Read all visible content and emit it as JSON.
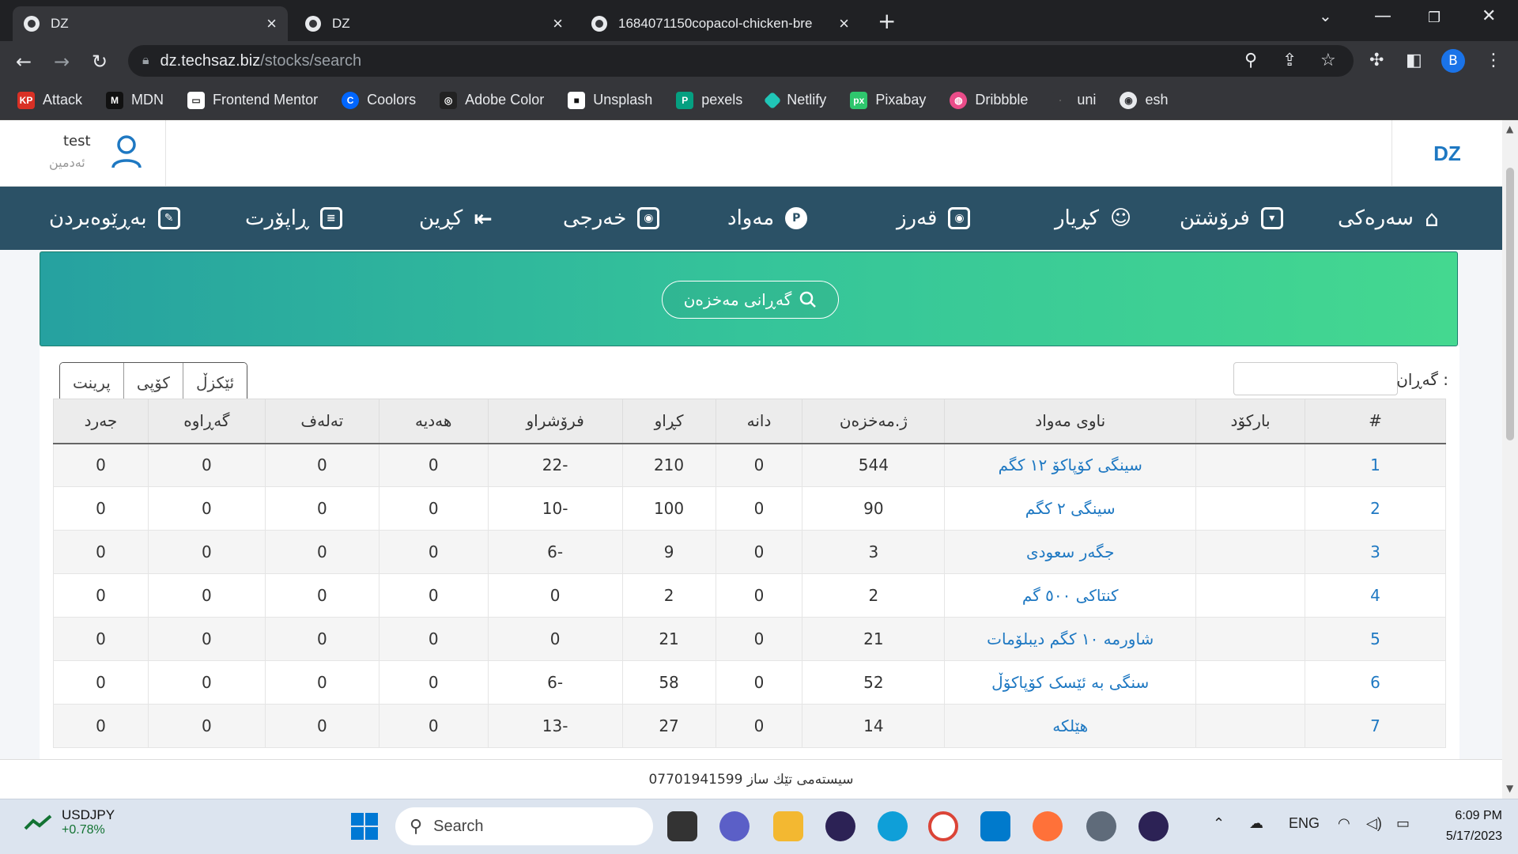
{
  "browser": {
    "tabs": [
      {
        "title": "DZ"
      },
      {
        "title": "DZ"
      },
      {
        "title": "1684071150copacol-chicken-bre"
      }
    ],
    "new_tab": "+",
    "url_host": "dz.techsaz.biz",
    "url_path": "/stocks/search",
    "profile_initial": "B",
    "bookmarks": [
      "Attack",
      "MDN",
      "Frontend Mentor",
      "Coolors",
      "Adobe Color",
      "Unsplash",
      "pexels",
      "Netlify",
      "Pixabay",
      "Dribbble",
      "uni",
      "esh"
    ]
  },
  "header": {
    "user_name": "test",
    "user_role": "ئەدمین",
    "brand": "DZ"
  },
  "nav": {
    "items": [
      "سەرەکی",
      "فرۆشتن",
      "کڕیار",
      "قەرز",
      "مەواد",
      "خەرجی",
      "کڕین",
      "ڕاپۆرت",
      "بەڕێوەبردن"
    ]
  },
  "banner": {
    "search_button": "گەڕانی مەخزەن"
  },
  "toolbar": {
    "excel": "ئێکزڵ",
    "copy": "کۆپی",
    "print": "پرینت",
    "filter_label": "گەڕان :"
  },
  "table": {
    "columns": [
      "#",
      "بارکۆد",
      "ناوی مەواد",
      "ژ.مەخزەن",
      "دانە",
      "کڕاو",
      "فرۆشراو",
      "هەدیە",
      "تەلەف",
      "گەڕاوە",
      "جەرد"
    ],
    "rows": [
      [
        "1",
        "",
        "سینگی کۆپاکۆ ١٢ کگم",
        "544",
        "0",
        "210",
        "22-",
        "0",
        "0",
        "0",
        "0"
      ],
      [
        "2",
        "",
        "سینگی ٢ کگم",
        "90",
        "0",
        "100",
        "10-",
        "0",
        "0",
        "0",
        "0"
      ],
      [
        "3",
        "",
        "جگەر سعودی",
        "3",
        "0",
        "9",
        "6-",
        "0",
        "0",
        "0",
        "0"
      ],
      [
        "4",
        "",
        "کنتاکی ٥٠٠ گم",
        "2",
        "0",
        "2",
        "0",
        "0",
        "0",
        "0",
        "0"
      ],
      [
        "5",
        "",
        "شاورمە ١٠ کگم دیبلۆمات",
        "21",
        "0",
        "21",
        "0",
        "0",
        "0",
        "0",
        "0"
      ],
      [
        "6",
        "",
        "سنگی بە ئێسک کۆپاکۆڵ",
        "52",
        "0",
        "58",
        "6-",
        "0",
        "0",
        "0",
        "0"
      ],
      [
        "7",
        "",
        "هێلکە",
        "14",
        "0",
        "27",
        "13-",
        "0",
        "0",
        "0",
        "0"
      ]
    ]
  },
  "footer": {
    "text": "سیستەمی تێك ساز 07701941599"
  },
  "taskbar": {
    "ticker_symbol": "USDJPY",
    "ticker_change": "+0.78%",
    "search_placeholder": "Search",
    "lang": "ENG",
    "time": "6:09 PM",
    "date": "5/17/2023"
  }
}
